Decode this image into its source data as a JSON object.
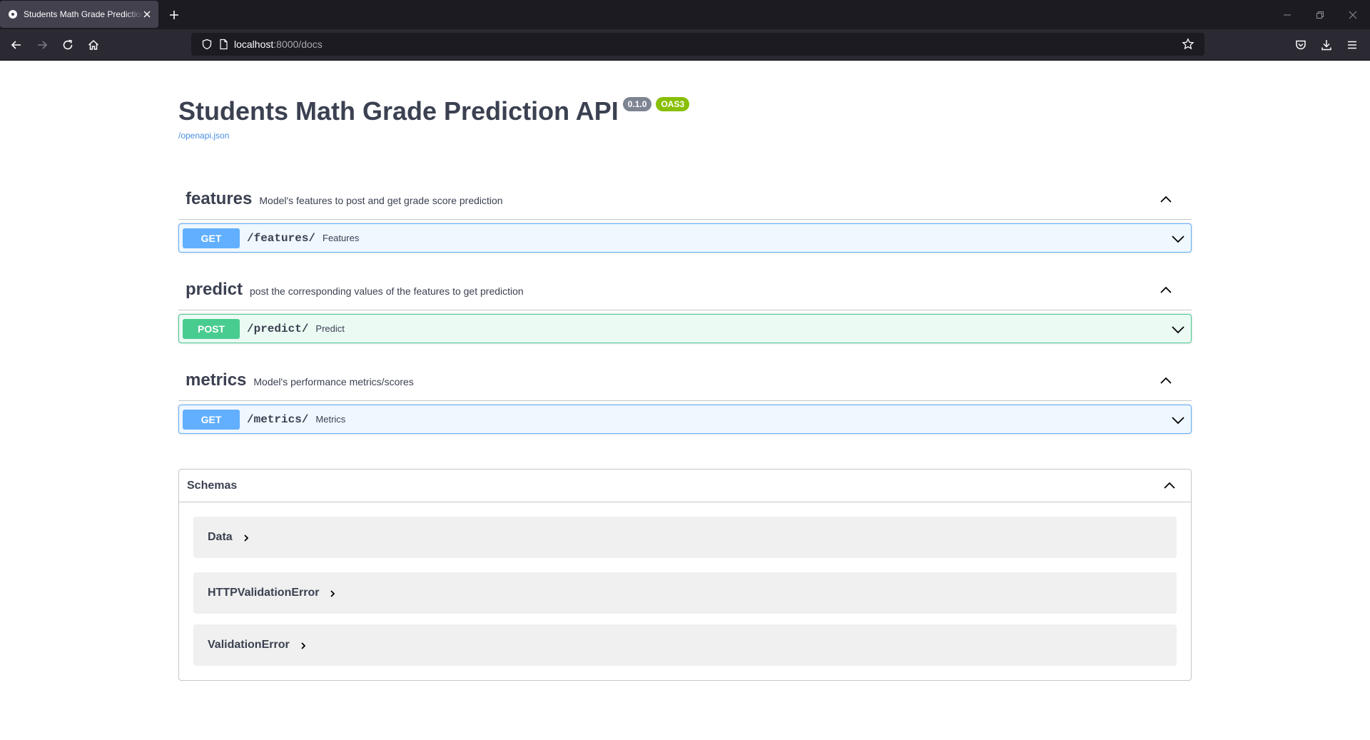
{
  "browser": {
    "tab_title": "Students Math Grade Prediction API - Swagger UI",
    "url_host": "localhost",
    "url_rest": ":8000/docs"
  },
  "api": {
    "title": "Students Math Grade Prediction API",
    "version": "0.1.0",
    "oas": "OAS3",
    "spec_link": "/openapi.json"
  },
  "tags": [
    {
      "name": "features",
      "description": "Model's features to post and get grade score prediction",
      "operation": {
        "method": "GET",
        "path": "/features/",
        "summary": "Features"
      }
    },
    {
      "name": "predict",
      "description": "post the corresponding values of the features to get prediction",
      "operation": {
        "method": "POST",
        "path": "/predict/",
        "summary": "Predict"
      }
    },
    {
      "name": "metrics",
      "description": "Model's performance metrics/scores",
      "operation": {
        "method": "GET",
        "path": "/metrics/",
        "summary": "Metrics"
      }
    }
  ],
  "schemas": {
    "title": "Schemas",
    "models": [
      "Data",
      "HTTPValidationError",
      "ValidationError"
    ]
  },
  "colors": {
    "get": "#61affe",
    "post": "#49cc90",
    "text": "#3b4151",
    "link": "#4990e2"
  }
}
